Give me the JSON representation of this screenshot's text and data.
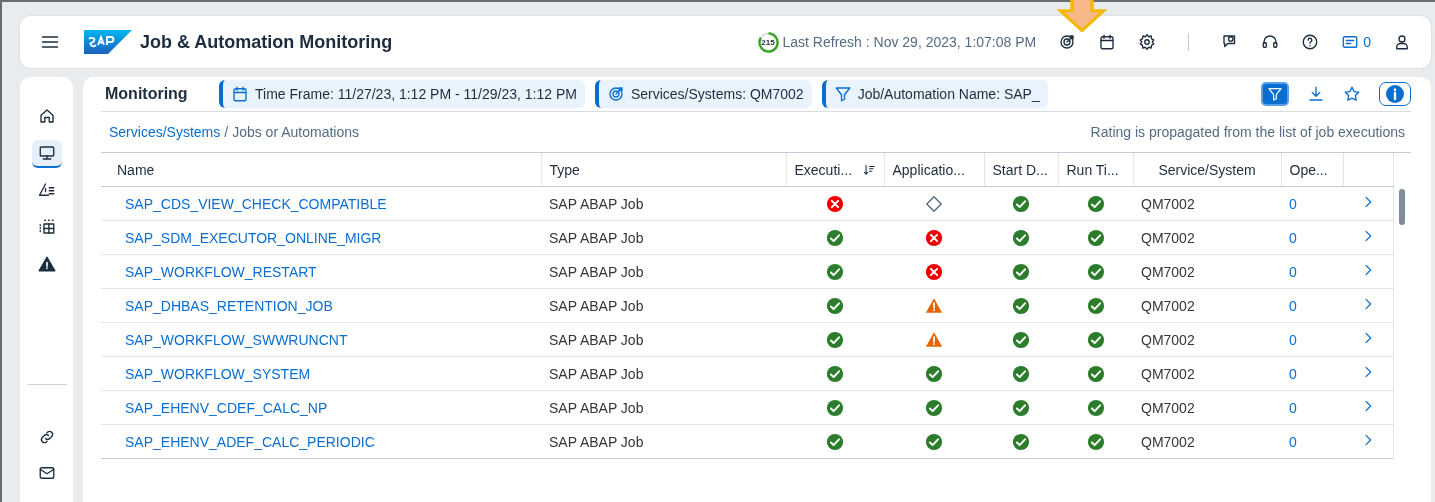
{
  "header": {
    "title": "Job & Automation Monitoring",
    "refresh_counter": "215",
    "last_refresh": "Last Refresh : Nov 29, 2023, 1:07:08 PM",
    "notifications": "0"
  },
  "sidebar": {
    "items": [
      {
        "kind": "home",
        "selected": false
      },
      {
        "kind": "monitor",
        "selected": true
      },
      {
        "kind": "alert-list",
        "selected": false
      },
      {
        "kind": "grid",
        "selected": false
      },
      {
        "kind": "warning",
        "selected": false
      }
    ],
    "bottom_items": [
      {
        "kind": "link"
      },
      {
        "kind": "mail"
      }
    ]
  },
  "toolbar": {
    "title": "Monitoring",
    "filters": [
      {
        "kind": "calendar",
        "label": "Time Frame: 11/27/23, 1:12 PM - 11/29/23, 1:12 PM"
      },
      {
        "kind": "target",
        "label": "Services/Systems: QM7002"
      },
      {
        "kind": "filter",
        "label": "Job/Automation Name: SAP_"
      }
    ]
  },
  "breadcrumb": {
    "link": "Services/Systems",
    "separator": "/",
    "current": "Jobs or Automations"
  },
  "note": "Rating is propagated from the list of job executions",
  "table": {
    "columns": [
      "Name",
      "Type",
      "Executi...",
      "Applicatio...",
      "Start D...",
      "Run Ti...",
      "Service/System",
      "Ope..."
    ],
    "rows": [
      {
        "name": "SAP_CDS_VIEW_CHECK_COMPATIBLE",
        "type": "SAP ABAP Job",
        "ratings": [
          {
            "kind": "error"
          },
          {
            "kind": "none"
          },
          {
            "kind": "success"
          },
          {
            "kind": "success"
          }
        ],
        "system": "QM7002",
        "open": "0"
      },
      {
        "name": "SAP_SDM_EXECUTOR_ONLINE_MIGR",
        "type": "SAP ABAP Job",
        "ratings": [
          {
            "kind": "success"
          },
          {
            "kind": "error"
          },
          {
            "kind": "success"
          },
          {
            "kind": "success"
          }
        ],
        "system": "QM7002",
        "open": "0"
      },
      {
        "name": "SAP_WORKFLOW_RESTART",
        "type": "SAP ABAP Job",
        "ratings": [
          {
            "kind": "success"
          },
          {
            "kind": "error"
          },
          {
            "kind": "success"
          },
          {
            "kind": "success"
          }
        ],
        "system": "QM7002",
        "open": "0"
      },
      {
        "name": "SAP_DHBAS_RETENTION_JOB",
        "type": "SAP ABAP Job",
        "ratings": [
          {
            "kind": "success"
          },
          {
            "kind": "warning"
          },
          {
            "kind": "success"
          },
          {
            "kind": "success"
          }
        ],
        "system": "QM7002",
        "open": "0"
      },
      {
        "name": "SAP_WORKFLOW_SWWRUNCNT",
        "type": "SAP ABAP Job",
        "ratings": [
          {
            "kind": "success"
          },
          {
            "kind": "warning"
          },
          {
            "kind": "success"
          },
          {
            "kind": "success"
          }
        ],
        "system": "QM7002",
        "open": "0"
      },
      {
        "name": "SAP_WORKFLOW_SYSTEM",
        "type": "SAP ABAP Job",
        "ratings": [
          {
            "kind": "success"
          },
          {
            "kind": "success"
          },
          {
            "kind": "success"
          },
          {
            "kind": "success"
          }
        ],
        "system": "QM7002",
        "open": "0"
      },
      {
        "name": "SAP_EHENV_CDEF_CALC_NP",
        "type": "SAP ABAP Job",
        "ratings": [
          {
            "kind": "success"
          },
          {
            "kind": "success"
          },
          {
            "kind": "success"
          },
          {
            "kind": "success"
          }
        ],
        "system": "QM7002",
        "open": "0"
      },
      {
        "name": "SAP_EHENV_ADEF_CALC_PERIODIC",
        "type": "SAP ABAP Job",
        "ratings": [
          {
            "kind": "success"
          },
          {
            "kind": "success"
          },
          {
            "kind": "success"
          },
          {
            "kind": "success"
          }
        ],
        "system": "QM7002",
        "open": "0"
      }
    ]
  }
}
